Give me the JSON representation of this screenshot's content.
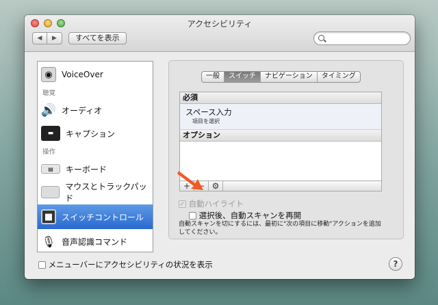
{
  "window": {
    "title": "アクセシビリティ"
  },
  "toolbar": {
    "show_all_label": "すべてを表示",
    "search_placeholder": ""
  },
  "sidebar": {
    "items": [
      {
        "label": "VoiceOver",
        "icon": "voiceover-icon"
      },
      {
        "category": "聴覚"
      },
      {
        "label": "オーディオ",
        "icon": "speaker-icon"
      },
      {
        "label": "キャプション",
        "icon": "caption-icon"
      },
      {
        "category": "操作"
      },
      {
        "label": "キーボード",
        "icon": "keyboard-icon"
      },
      {
        "label": "マウスとトラックパッド",
        "icon": "mouse-trackpad-icon"
      },
      {
        "label": "スイッチコントロール",
        "icon": "switch-control-icon",
        "selected": true
      },
      {
        "label": "音声認識コマンド",
        "icon": "microphone-icon"
      }
    ]
  },
  "tabs": [
    "一般",
    "スイッチ",
    "ナビゲーション",
    "タイミング"
  ],
  "active_tab": "スイッチ",
  "switch_list": {
    "required_header": "必須",
    "required_item_title": "スペース入力",
    "required_item_sub": "項目を選択",
    "options_header": "オプション",
    "add_label": "+",
    "remove_label": "−",
    "settings_label": "⚙"
  },
  "options": {
    "auto_highlight_label": "自動ハイライト",
    "resume_scan_label": "選択後、自動スキャンを再開",
    "note": "自動スキャンを切にするには、最初に\"次の項目に移動\"アクションを追加してください。"
  },
  "bottom": {
    "menubar_checkbox_label": "メニューバーにアクセシビリティの状況を表示",
    "help_label": "?"
  },
  "colors": {
    "selection": "#2a69cf",
    "arrow": "#f15a24"
  }
}
